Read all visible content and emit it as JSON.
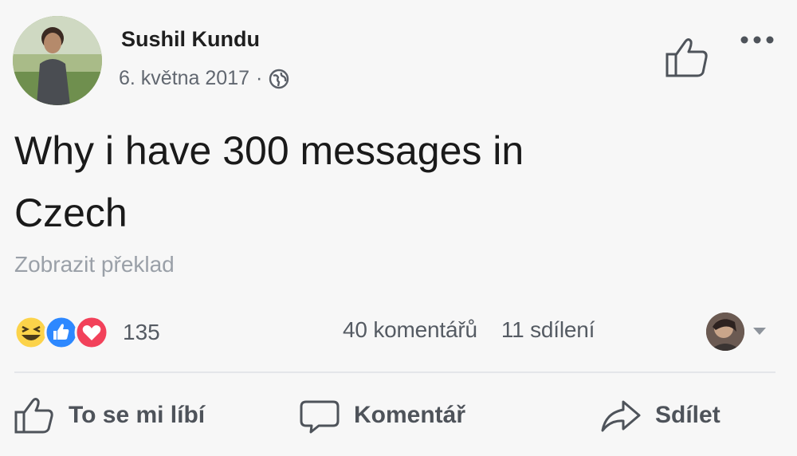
{
  "post": {
    "author": "Sushil Kundu",
    "date": "6. května 2017",
    "separator": "·",
    "privacy_icon": "globe-icon",
    "text_line1": "Why i have 300 messages in",
    "text_line2": "Czech",
    "translate_link": "Zobrazit překlad"
  },
  "stats": {
    "reaction_icons": [
      "haha-icon",
      "like-icon",
      "love-icon"
    ],
    "reactions_count": "135",
    "comments": "40 komentářů",
    "shares": "11 sdílení"
  },
  "actions": {
    "like": "To se mi líbí",
    "comment": "Komentář",
    "share": "Sdílet"
  },
  "colors": {
    "like_blue": "#2d88ff",
    "love_red": "#f2415a",
    "haha_yellow": "#fcd34a",
    "muted_text": "#616770"
  }
}
